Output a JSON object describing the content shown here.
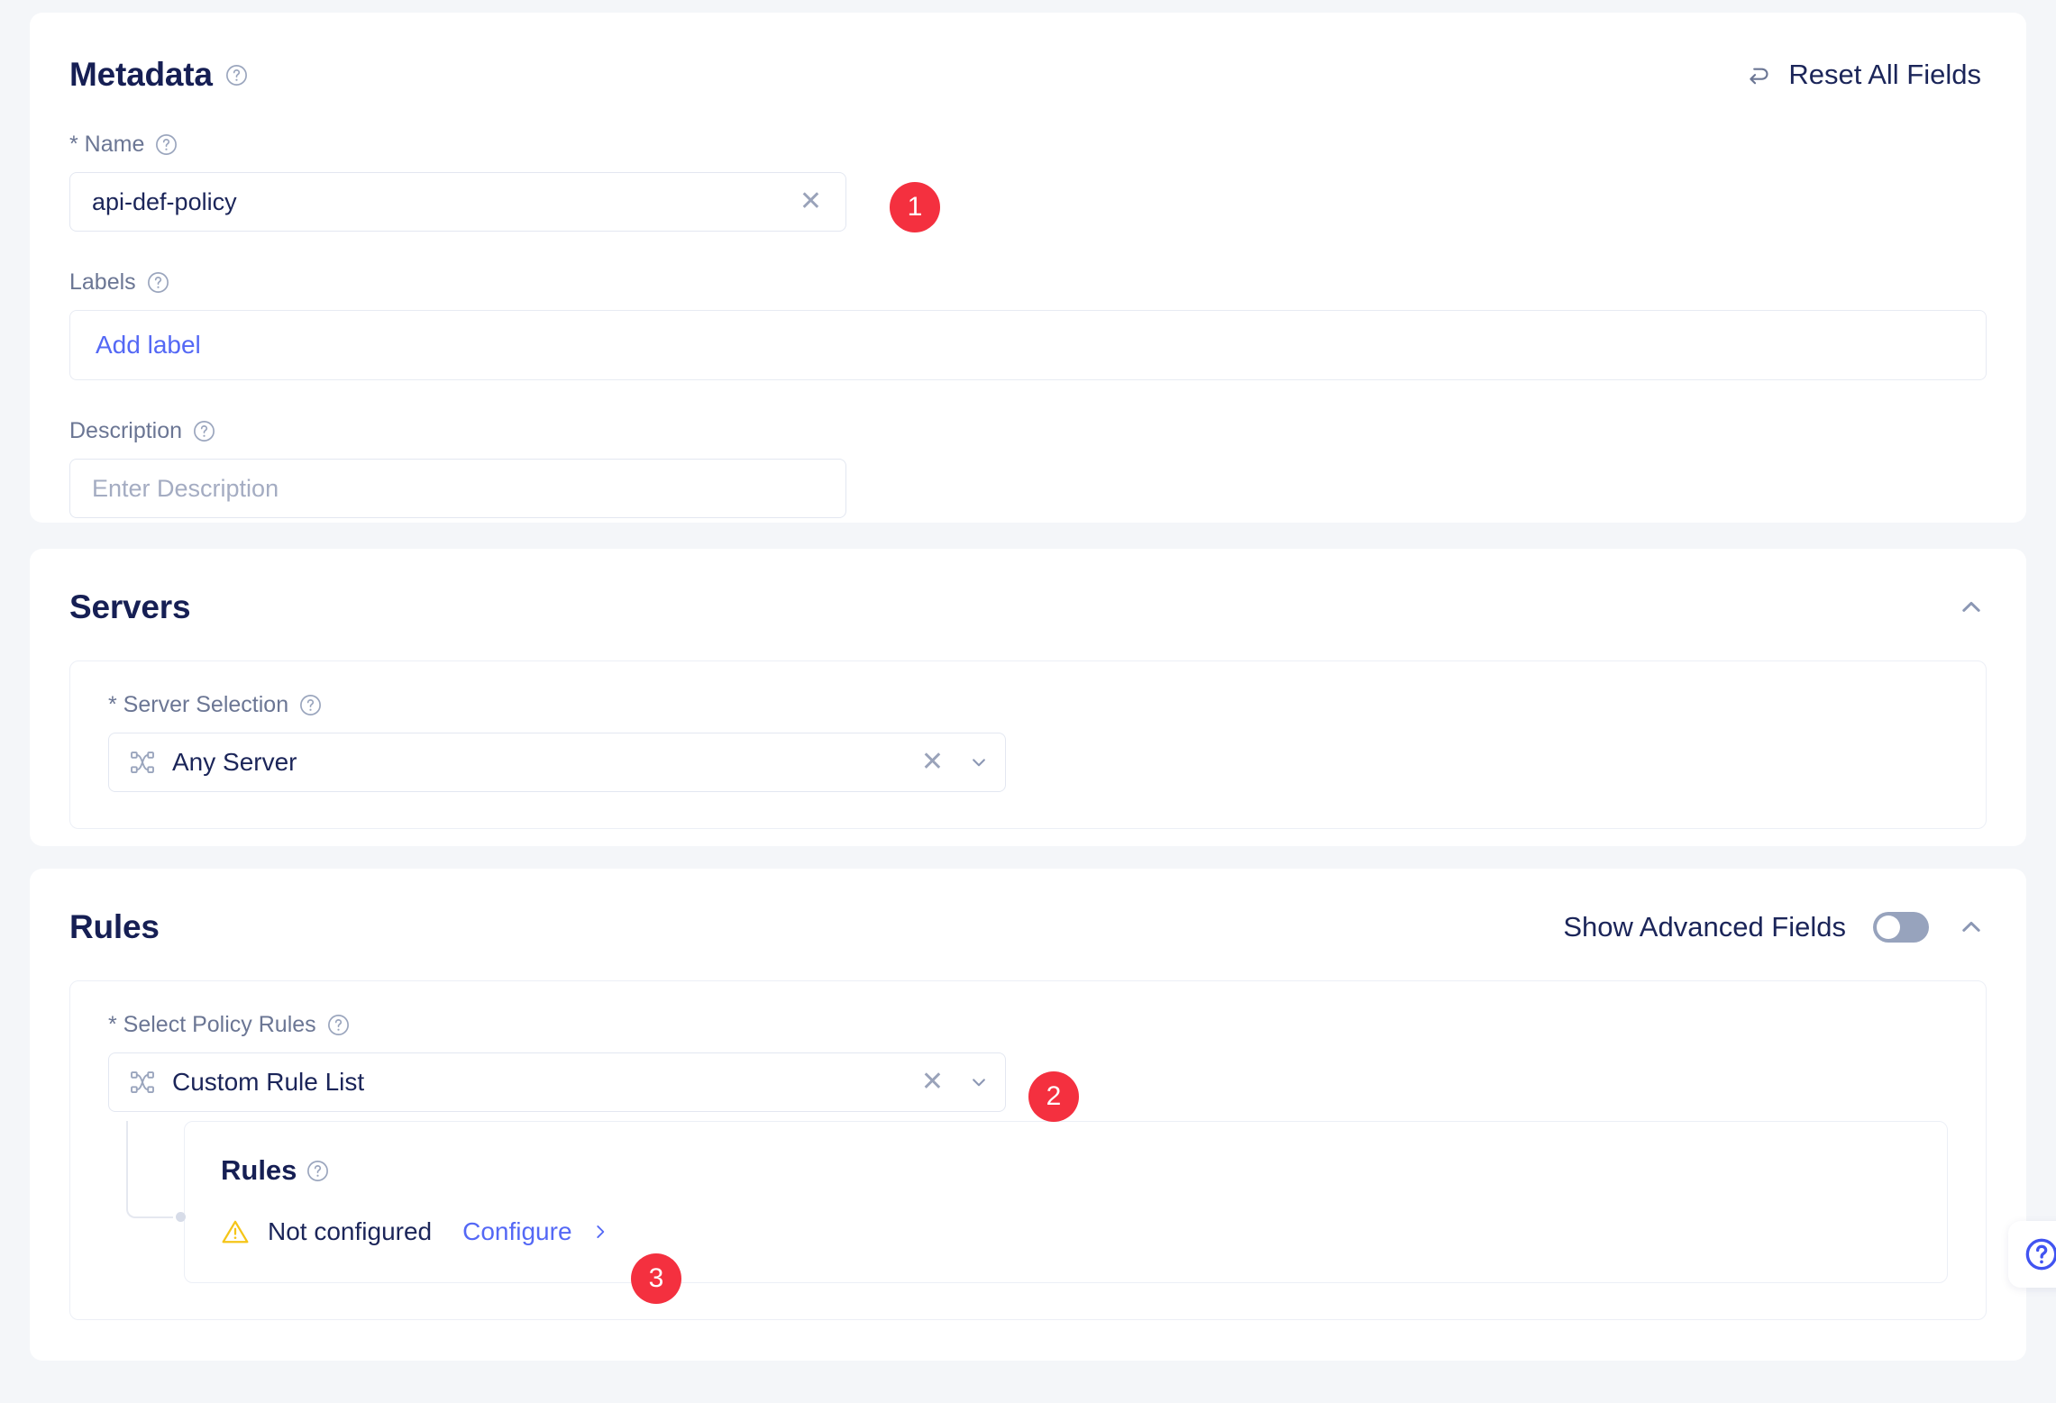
{
  "metadata": {
    "title": "Metadata",
    "help_icon": "help-circle-icon",
    "reset": {
      "label": "Reset All Fields",
      "icon": "undo-arrow-icon"
    },
    "name_field": {
      "label": "* Name",
      "value": "api-def-policy",
      "clear_icon": "close-icon",
      "help_icon": "help-circle-icon"
    },
    "labels_field": {
      "label": "Labels",
      "add_label": "Add label",
      "help_icon": "help-circle-icon"
    },
    "description_field": {
      "label": "Description",
      "placeholder": "Enter Description",
      "help_icon": "help-circle-icon"
    }
  },
  "servers": {
    "title": "Servers",
    "collapse_icon": "chevron-up-icon",
    "server_selection": {
      "label": "* Server Selection",
      "help_icon": "help-circle-icon",
      "value": "Any Server",
      "prefix_icon": "shuffle-nodes-icon",
      "clear_icon": "close-icon",
      "caret_icon": "chevron-down-icon"
    }
  },
  "rules": {
    "title": "Rules",
    "show_advanced_label": "Show Advanced Fields",
    "toggle_state": "off",
    "collapse_icon": "chevron-up-icon",
    "select_policy_rules": {
      "label": "* Select Policy Rules",
      "help_icon": "help-circle-icon",
      "value": "Custom Rule List",
      "prefix_icon": "shuffle-nodes-icon",
      "clear_icon": "close-icon",
      "caret_icon": "chevron-down-icon"
    },
    "nested_rules": {
      "title": "Rules",
      "help_icon": "help-circle-icon",
      "status_icon": "warning-triangle-icon",
      "status_text": "Not configured",
      "configure_label": "Configure",
      "configure_caret_icon": "chevron-right-icon"
    }
  },
  "step_badges": [
    {
      "number": "1",
      "target": "name-input"
    },
    {
      "number": "2",
      "target": "select-policy-rules"
    },
    {
      "number": "3",
      "target": "configure-link"
    }
  ],
  "help_bubble": {
    "icon": "help-circle-icon"
  },
  "colors": {
    "badge_red": "#f4303f",
    "link_blue": "#5468f5",
    "heading_navy": "#161f54",
    "label_grey": "#6b7694",
    "warning_yellow": "#f5c518",
    "page_bg": "#f4f6f9",
    "card_bg": "#ffffff",
    "toggle_off": "#97a3bd"
  }
}
